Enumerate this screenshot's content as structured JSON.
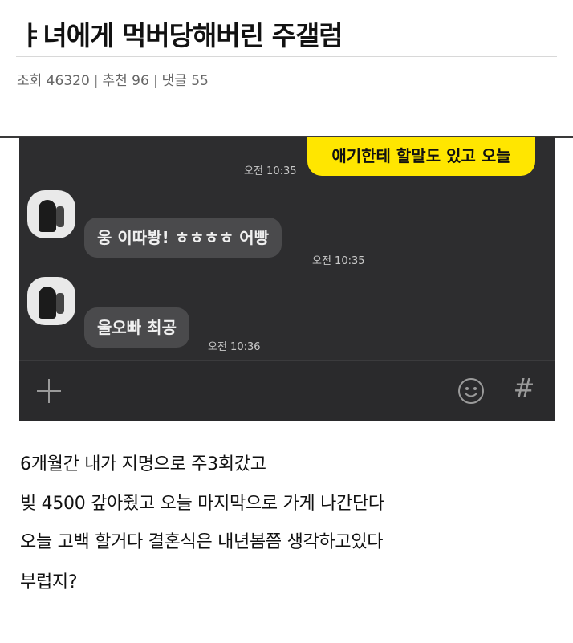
{
  "post": {
    "title": "ㅑ녀에게 먹버당해버린 주갤럼",
    "views": "조회 46320",
    "recommend": "추천 96",
    "comments": "댓글 55",
    "separator": "|"
  },
  "chat": {
    "messages": [
      {
        "side": "me",
        "text": "애기한테 할말도 있고 오늘",
        "time": "오전 10:35"
      },
      {
        "side": "other",
        "text": "웅 이따봥! ㅎㅎㅎㅎ 어빵",
        "time": "오전 10:35"
      },
      {
        "side": "other",
        "text": "울오빠 최공",
        "time": "오전 10:36"
      }
    ],
    "icons": {
      "add": "plus-icon",
      "emoji": "smiley-icon",
      "hashtag": "hash-icon"
    },
    "colors": {
      "background": "#2d2d2f",
      "my_bubble": "#ffe600",
      "other_bubble": "#4a4a4c"
    }
  },
  "body": {
    "lines": [
      "6개월간 내가 지명으로 주3회갔고",
      "빚 4500 갚아줬고 오늘 마지막으로 가게 나간단다",
      "오늘 고백 할거다 결혼식은 내년봄쯤 생각하고있다",
      "부럽지?"
    ]
  }
}
